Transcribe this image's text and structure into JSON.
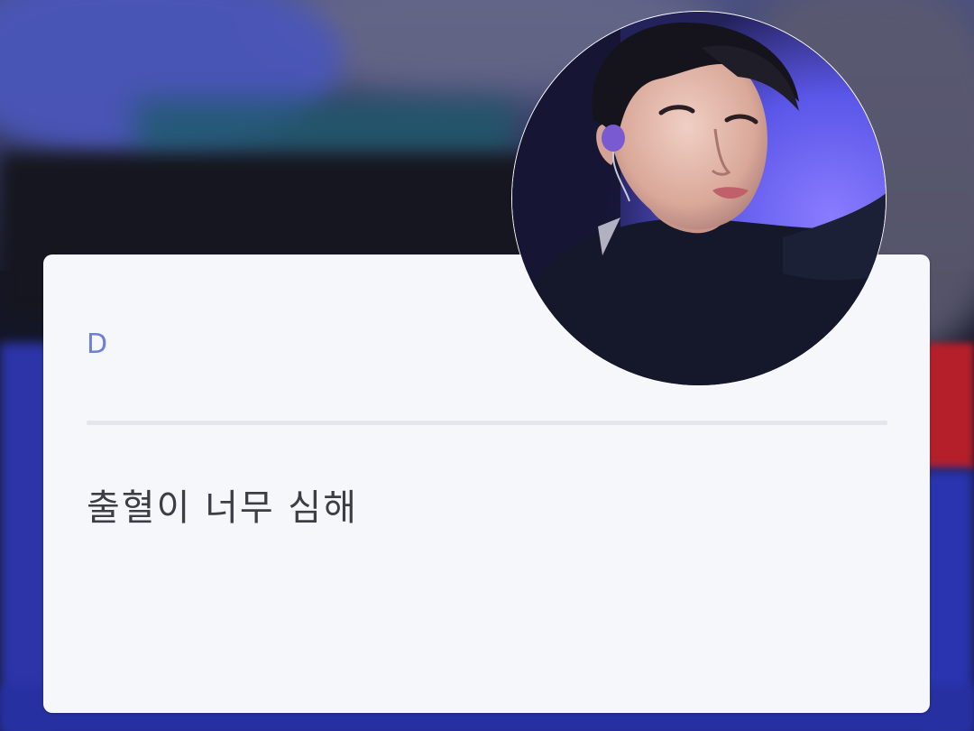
{
  "card": {
    "label": "D",
    "message": "출혈이 너무 심해"
  },
  "avatar": {
    "icon": "profile-photo"
  },
  "colors": {
    "card_background": "#f5f7fa",
    "label_color": "#6d7fd8",
    "message_color": "#3b3e45",
    "divider_color": "#e3e6ec"
  }
}
